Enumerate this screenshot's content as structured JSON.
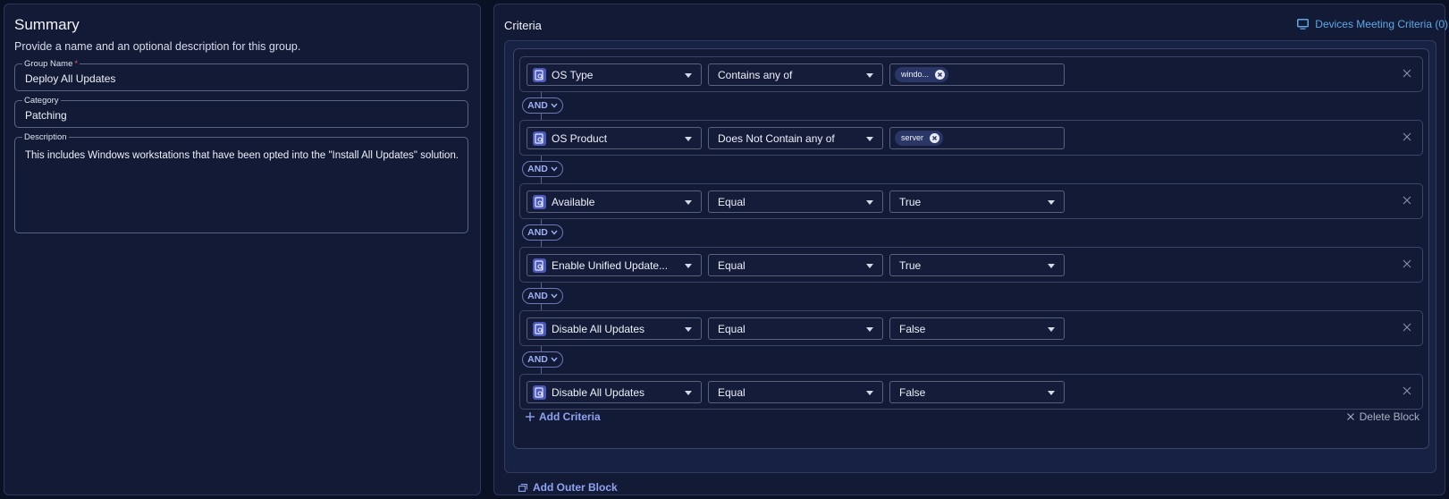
{
  "summary": {
    "title": "Summary",
    "subtitle": "Provide a name and an optional description for this group.",
    "group_name": {
      "label": "Group Name",
      "required_mark": "*",
      "value": "Deploy All Updates"
    },
    "category": {
      "label": "Category",
      "value": "Patching"
    },
    "description": {
      "label": "Description",
      "value": "This includes Windows workstations that have been opted into the \"Install All Updates\" solution."
    }
  },
  "criteria": {
    "title": "Criteria",
    "devices_link": "Devices Meeting Criteria (0)",
    "rows": [
      {
        "field": "OS Type",
        "operator": "Contains any of",
        "chip": "windo..."
      },
      {
        "field": "OS Product",
        "operator": "Does Not Contain any of",
        "chip": "server"
      },
      {
        "field": "Available",
        "operator": "Equal",
        "value": "True"
      },
      {
        "field": "Enable Unified Update...",
        "operator": "Equal",
        "value": "True"
      },
      {
        "field": "Disable All Updates",
        "operator": "Equal",
        "value": "False"
      },
      {
        "field": "Disable All Updates",
        "operator": "Equal",
        "value": "False"
      }
    ],
    "connector": "AND",
    "add_criteria": "Add Criteria",
    "delete_block": "Delete Block",
    "add_outer_block": "Add Outer Block"
  },
  "colors": {
    "background": "#0b1124",
    "panel": "#121a36",
    "accent": "#8fa3f0",
    "link": "#5fa8e6",
    "required": "#e0566d"
  },
  "icons": [
    "monitor-icon",
    "search-doc-icon",
    "chevron-down-icon",
    "close-icon",
    "chip-remove-icon",
    "plus-icon",
    "block-icon"
  ]
}
